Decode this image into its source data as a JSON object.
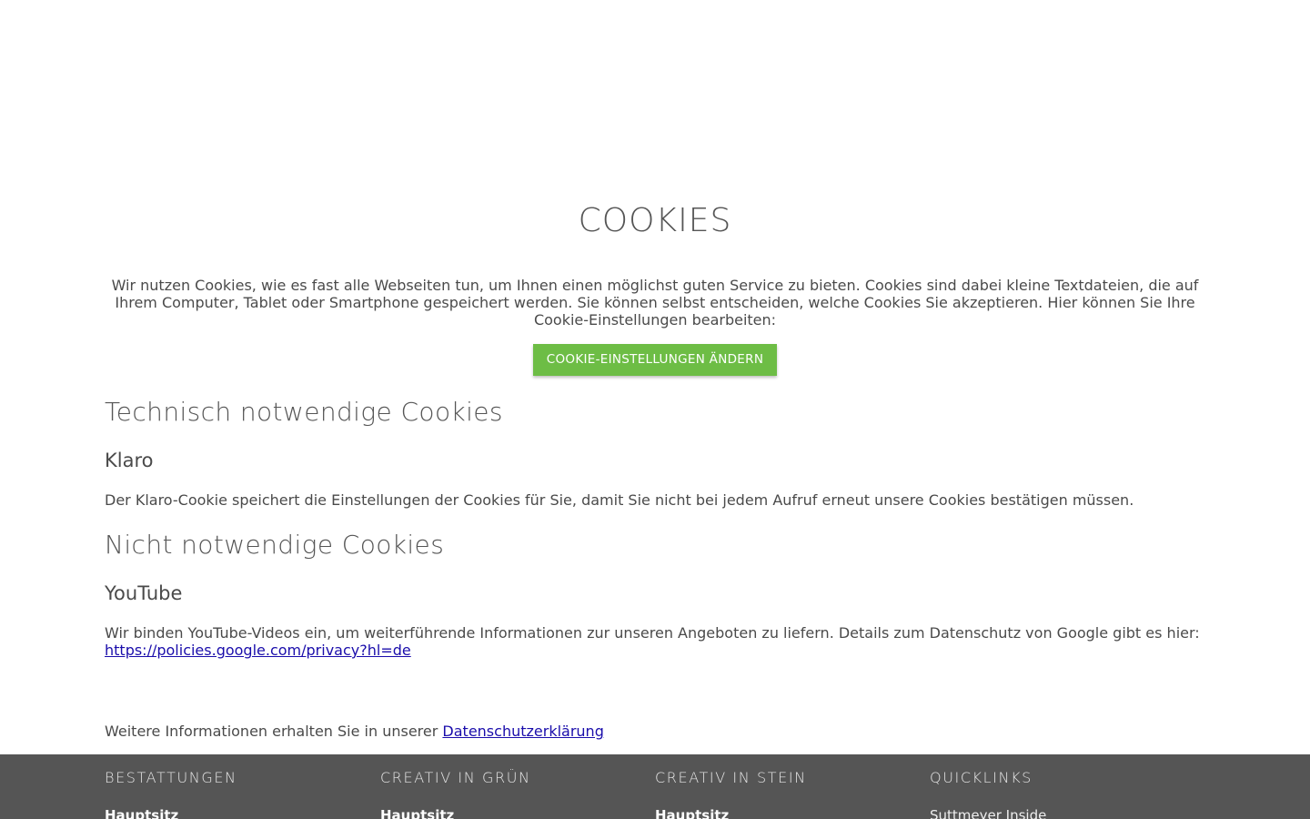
{
  "main": {
    "title": "COOKIES",
    "intro": "Wir nutzen Cookies, wie es fast alle Webseiten tun, um Ihnen einen möglichst guten Service zu bieten. Cookies sind dabei kleine Textdateien, die auf Ihrem Computer, Tablet oder Smartphone gespeichert werden. Sie können selbst entscheiden, welche Cookies Sie akzeptieren. Hier können Sie Ihre Cookie-Einstellungen bearbeiten:",
    "settings_button": "COOKIE-EINSTELLUNGEN ÄNDERN",
    "sections": [
      {
        "heading": "Technisch notwendige Cookies",
        "subheading": "Klaro",
        "text": "Der Klaro-Cookie speichert die Einstellungen der Cookies für Sie, damit Sie nicht bei jedem Aufruf erneut unsere Cookies bestätigen müssen."
      },
      {
        "heading": "Nicht notwendige Cookies",
        "subheading": "YouTube",
        "text": "Wir binden YouTube-Videos ein, um weiterführende Informationen zur unseren Angeboten zu liefern. Details zum Datenschutz von Google gibt es hier:",
        "link": "https://policies.google.com/privacy?hl=de"
      }
    ],
    "more_info_text": "Weitere Informationen erhalten Sie in unserer",
    "privacy_link": "Datenschutzerklärung"
  },
  "footer": {
    "columns": [
      {
        "heading": "BESTATTUNGEN",
        "first_item": "Hauptsitz"
      },
      {
        "heading": "CREATIV IN GRÜN",
        "first_item": "Hauptsitz"
      },
      {
        "heading": "CREATIV IN STEIN",
        "first_item": "Hauptsitz"
      },
      {
        "heading": "QUICKLINKS",
        "first_item": "Suttmeyer Inside"
      }
    ]
  },
  "colors": {
    "accent_green": "#6dbd45",
    "footer_bg": "#555555",
    "link": "#1a0dab"
  }
}
